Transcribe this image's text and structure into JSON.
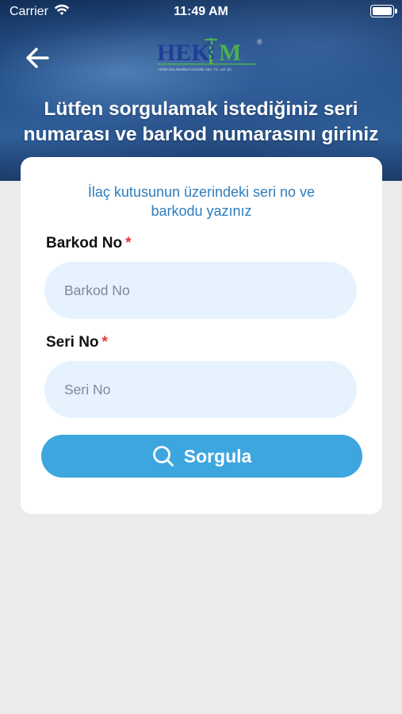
{
  "status_bar": {
    "carrier": "Carrier",
    "time": "11:49 AM"
  },
  "header": {
    "logo_text": "HEKIM",
    "logo_subtitle": "Hekim İlaç Medikal Kozmetik San. Tic. Ltd. Şti.",
    "title": "Lütfen sorgulamak istediğiniz seri numarası ve barkod numarasını giriniz"
  },
  "form": {
    "instruction": "İlaç kutusunun üzerindeki seri no ve barkodu yazınız",
    "barkod": {
      "label": "Barkod No",
      "required_mark": "*",
      "placeholder": "Barkod No",
      "value": ""
    },
    "seri": {
      "label": "Seri No",
      "required_mark": "*",
      "placeholder": "Seri No",
      "value": ""
    },
    "submit_label": "Sorgula"
  },
  "colors": {
    "accent": "#3ea6df",
    "input_bg": "#e6f2fe",
    "required": "#e53935",
    "instruction_text": "#2f7dbd",
    "logo_blue": "#1f3f96",
    "logo_green": "#4caf50"
  },
  "icons": {
    "back": "arrow-left-icon",
    "search": "search-icon",
    "wifi": "wifi-icon",
    "battery": "battery-icon"
  }
}
